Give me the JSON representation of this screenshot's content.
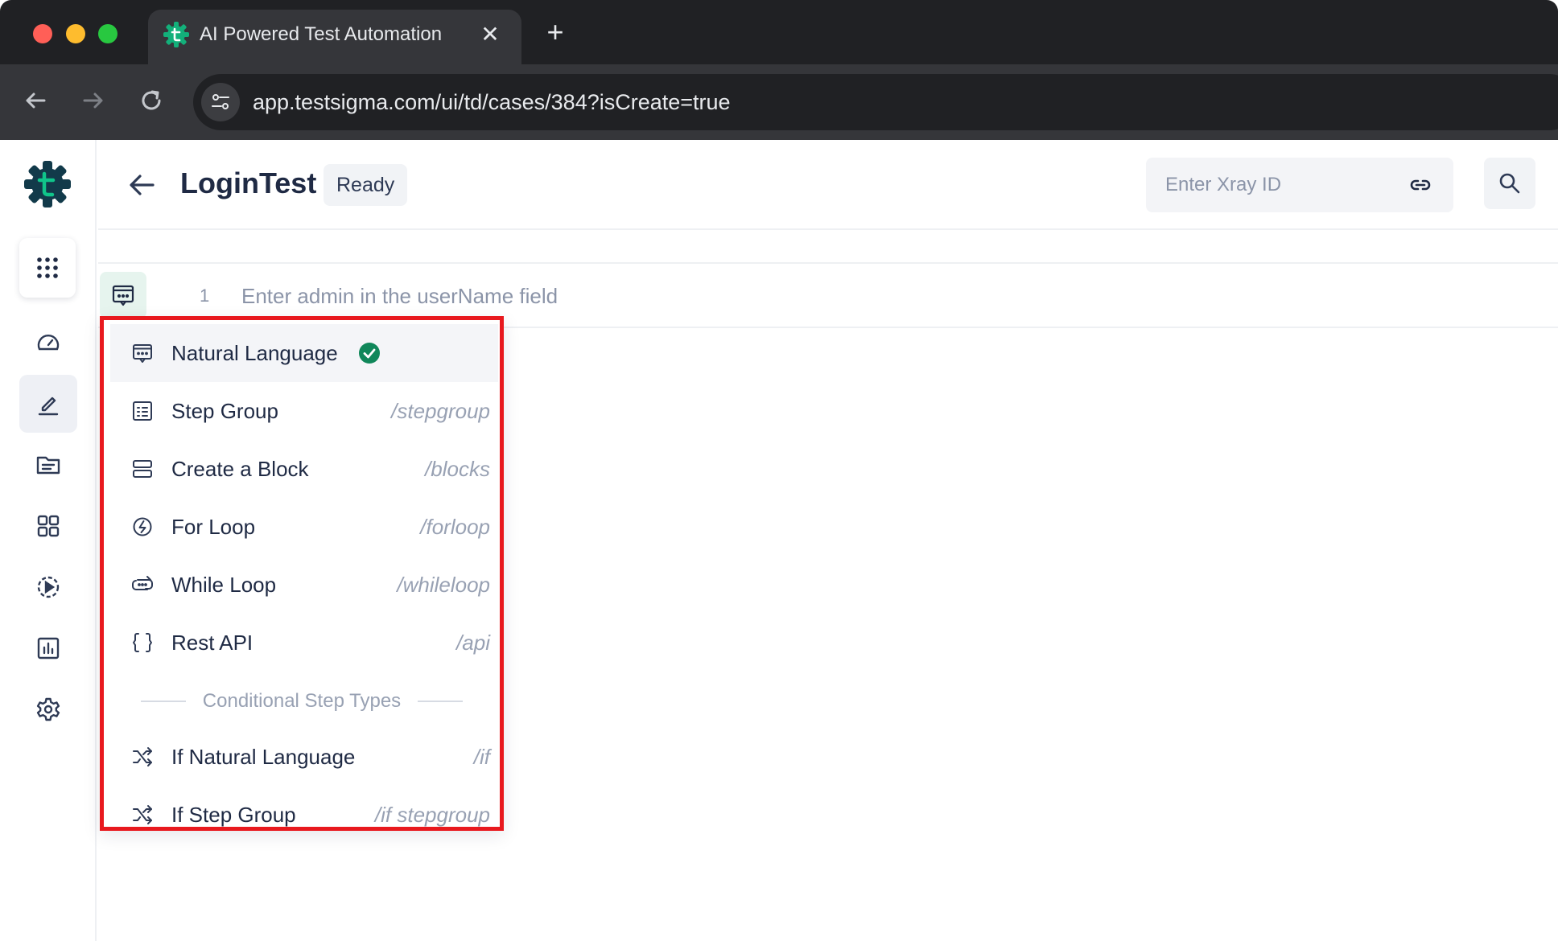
{
  "browser": {
    "tab_title": "AI Powered Test Automation",
    "tab_close": "✕",
    "new_tab": "+",
    "url": "app.testsigma.com/ui/td/cases/384?isCreate=true"
  },
  "header": {
    "title": "LoginTest",
    "status": "Ready",
    "xray_placeholder": "Enter Xray ID"
  },
  "step": {
    "number": "1",
    "text": "Enter admin in the userName field"
  },
  "dropdown": {
    "items": [
      {
        "label": "Natural Language",
        "shortcut": "",
        "icon": "natural-language-icon",
        "selected": true
      },
      {
        "label": "Step Group",
        "shortcut": "/stepgroup",
        "icon": "step-group-icon"
      },
      {
        "label": "Create a Block",
        "shortcut": "/blocks",
        "icon": "block-icon"
      },
      {
        "label": "For Loop",
        "shortcut": "/forloop",
        "icon": "for-loop-icon"
      },
      {
        "label": "While Loop",
        "shortcut": "/whileloop",
        "icon": "while-loop-icon"
      },
      {
        "label": "Rest API",
        "shortcut": "/api",
        "icon": "braces-icon"
      }
    ],
    "section_label": "Conditional Step Types",
    "conditional_items": [
      {
        "label": "If Natural Language",
        "shortcut": "/if",
        "icon": "shuffle-icon"
      },
      {
        "label": "If Step Group",
        "shortcut": "/if stepgroup",
        "icon": "shuffle-icon"
      }
    ]
  },
  "colors": {
    "brand": "#10875a",
    "highlight_border": "#e8191e",
    "chrome_dark": "#202124"
  }
}
